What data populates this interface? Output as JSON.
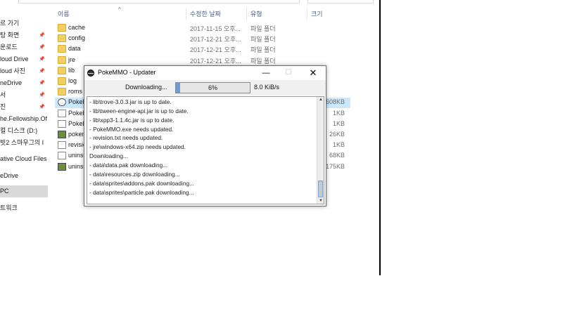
{
  "explorer": {
    "columns": {
      "name": "이름",
      "modified": "수정한 날짜",
      "type": "유형",
      "size": "크기"
    },
    "nav": [
      {
        "label": "르 가기",
        "pinned": false
      },
      {
        "label": "탕 화면",
        "pinned": true
      },
      {
        "label": "운로드",
        "pinned": true
      },
      {
        "label": "loud Drive",
        "pinned": true
      },
      {
        "label": "loud 사진",
        "pinned": true
      },
      {
        "label": "neDrive",
        "pinned": true
      },
      {
        "label": "서",
        "pinned": true
      },
      {
        "label": "진",
        "pinned": true
      },
      {
        "label": "he.Fellowship.Of.T",
        "pinned": false
      },
      {
        "label": "컬 디스크 (D:)",
        "pinned": false
      },
      {
        "label": "빗2 스마우그의 I",
        "pinned": false
      },
      {
        "label": "ative Cloud Files",
        "pinned": false
      },
      {
        "label": "eDrive",
        "pinned": false
      },
      {
        "label": "PC",
        "pinned": false,
        "selected": true
      },
      {
        "label": "트워크",
        "pinned": false
      }
    ],
    "files": [
      {
        "name": "cache",
        "date": "2017-11-15 오후...",
        "type": "파일 폴더",
        "size": "",
        "icon": "folder-icon"
      },
      {
        "name": "config",
        "date": "2017-12-21 오후...",
        "type": "파일 폴더",
        "size": "",
        "icon": "folder-icon"
      },
      {
        "name": "data",
        "date": "2017-12-21 오후...",
        "type": "파일 폴더",
        "size": "",
        "icon": "folder-icon"
      },
      {
        "name": "jre",
        "date": "2017-12-21 오후...",
        "type": "파일 폴더",
        "size": "",
        "icon": "folder-icon"
      },
      {
        "name": "lib",
        "date": "",
        "type": "",
        "size": "",
        "icon": "folder-icon"
      },
      {
        "name": "log",
        "date": "",
        "type": "",
        "size": "",
        "icon": "folder-icon"
      },
      {
        "name": "roms",
        "date": "",
        "type": "",
        "size": "",
        "icon": "folder-icon"
      },
      {
        "name": "PokeM",
        "date": "",
        "type": "",
        "size": "1,608KB",
        "icon": "app-icon",
        "selected": true
      },
      {
        "name": "PokeM",
        "date": "",
        "type": "",
        "size": "1KB",
        "icon": "document-icon"
      },
      {
        "name": "PokeM",
        "date": "",
        "type": "",
        "size": "1KB",
        "icon": "document-icon"
      },
      {
        "name": "pokem",
        "date": "",
        "type": "",
        "size": "26KB",
        "icon": "settings-file-icon"
      },
      {
        "name": "revisio",
        "date": "",
        "type": "",
        "size": "1KB",
        "icon": "document-icon"
      },
      {
        "name": "unins0",
        "date": "",
        "type": "",
        "size": "68KB",
        "icon": "document-icon"
      },
      {
        "name": "unins0",
        "date": "",
        "type": "",
        "size": "1,175KB",
        "icon": "installer-icon"
      }
    ]
  },
  "updater": {
    "title": "PokeMMO - Updater",
    "min_glyph": "—",
    "max_glyph": "☐",
    "close_glyph": "✕",
    "status_label": "Downloading...",
    "progress_percent": 6,
    "progress_text": "6%",
    "speed": "8.0 KiB/s",
    "log": [
      "- lib\\trove-3.0.3.jar is up to date.",
      "- lib\\tween-engine-api.jar is up to date.",
      "- lib\\xpp3-1.1.4c.jar is up to date.",
      "- PokeMMO.exe needs updated.",
      "- revision.txt needs updated.",
      "- jre\\windows-x64.zip needs updated.",
      "Downloading...",
      "- data\\data.pak downloading...",
      "- data\\resources.zip downloading...",
      "- data\\sprites\\addons.pak downloading...",
      "- data\\sprites\\particle.pak downloading..."
    ]
  }
}
